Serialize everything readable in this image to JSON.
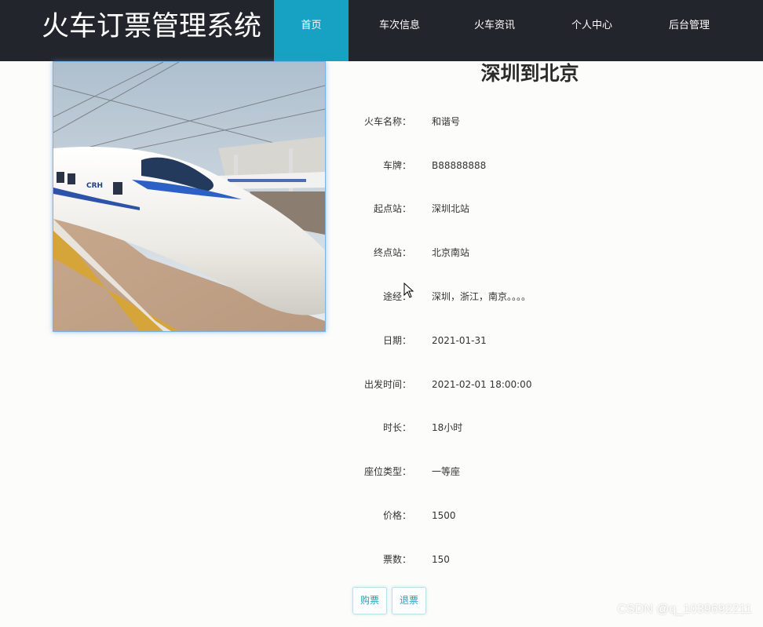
{
  "header": {
    "title": "火车订票管理系统",
    "nav": [
      {
        "label": "首页",
        "active": true
      },
      {
        "label": "车次信息",
        "active": false
      },
      {
        "label": "火车资讯",
        "active": false
      },
      {
        "label": "个人中心",
        "active": false
      },
      {
        "label": "后台管理",
        "active": false
      }
    ]
  },
  "detail": {
    "title": "深圳到北京",
    "fields": [
      {
        "label": "火车名称：",
        "value": "和谐号"
      },
      {
        "label": "车牌：",
        "value": "B88888888"
      },
      {
        "label": "起点站：",
        "value": "深圳北站"
      },
      {
        "label": "终点站：",
        "value": "北京南站"
      },
      {
        "label": "途经：",
        "value": "深圳，浙江，南京。。。。"
      },
      {
        "label": "日期：",
        "value": "2021-01-31"
      },
      {
        "label": "出发时间：",
        "value": "2021-02-01 18:00:00"
      },
      {
        "label": "时长：",
        "value": "18小时"
      },
      {
        "label": "座位类型：",
        "value": "一等座"
      },
      {
        "label": "价格：",
        "value": "1500"
      },
      {
        "label": "票数：",
        "value": "150"
      }
    ],
    "buttons": {
      "buy": "购票",
      "refund": "退票"
    }
  },
  "watermark": "CSDN @q_1039692211",
  "colors": {
    "nav_bg": "#22262c",
    "accent": "#17a2c3"
  }
}
